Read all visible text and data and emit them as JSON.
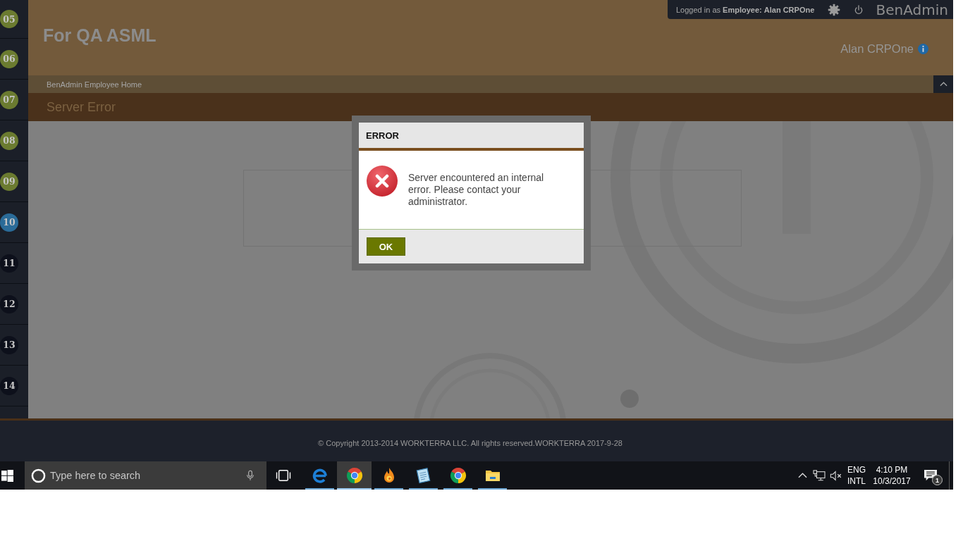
{
  "sidebar": {
    "steps": [
      {
        "label": "05",
        "color": "#6b7b30"
      },
      {
        "label": "06",
        "color": "#6b7b30"
      },
      {
        "label": "07",
        "color": "#6b7b30"
      },
      {
        "label": "08",
        "color": "#6b7b30"
      },
      {
        "label": "09",
        "color": "#6b7b30"
      },
      {
        "label": "10",
        "color": "#2a6b98"
      },
      {
        "label": "11",
        "color": "#0d101b"
      },
      {
        "label": "12",
        "color": "#0d101b"
      },
      {
        "label": "13",
        "color": "#0d101b"
      },
      {
        "label": "14",
        "color": "#0d101b"
      }
    ]
  },
  "header": {
    "title": "For QA ASML",
    "login_status": "Logged in as **Employee:** **Alan CRPOne**",
    "brand": "BenAdmin",
    "user_name": "Alan CRPOne"
  },
  "breadcrumb": {
    "items": [
      "BenAdmin Employee Home"
    ]
  },
  "page_title": "Server Error",
  "dialog": {
    "title": "ERROR",
    "message": "Server encountered an internal error. Please contact your administrator.",
    "buttons": [
      "OK"
    ]
  },
  "footer": {
    "copyright": "© Copyright 2013-2014 WORKTERRA LLC. All rights reserved.WORKTERRA 2017-9-28"
  },
  "taskbar": {
    "search": {
      "placeholder": "Type here to search"
    },
    "apps": [
      {
        "kind": "letter",
        "active": false
      },
      {
        "kind": "ring",
        "active": true
      },
      {
        "kind": "flame",
        "active": false
      },
      {
        "kind": "notepad",
        "active": false
      },
      {
        "kind": "ring",
        "active": false
      },
      {
        "kind": "folder",
        "active": false
      }
    ],
    "tray": {
      "volume": {
        "muted": true
      },
      "language": "ENG",
      "layout": "INTL",
      "time": "4:10 PM",
      "date": "10/3/2017",
      "notification_count": "1"
    }
  }
}
